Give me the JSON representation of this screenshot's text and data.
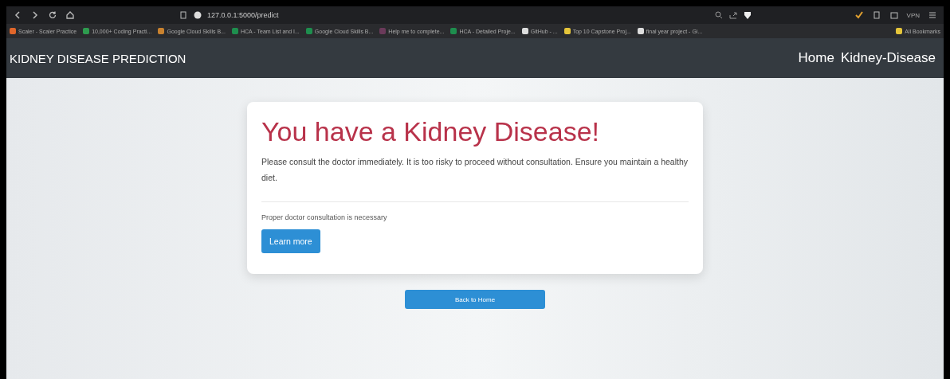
{
  "browser": {
    "url": "127.0.0.1:5000/predict",
    "vpn": "VPN",
    "bookmarks": [
      {
        "label": "Scaler - Scaler Practice",
        "color": "#e0662a"
      },
      {
        "label": "10,000+ Coding Practi...",
        "color": "#2e9b4f"
      },
      {
        "label": "Google Cloud Skills B...",
        "color": "#c9822f"
      },
      {
        "label": "HCA - Team List and I...",
        "color": "#1e8e4e"
      },
      {
        "label": "Google Cloud Skills B...",
        "color": "#1e8e4e"
      },
      {
        "label": "Help me to complete...",
        "color": "#6a3a5a"
      },
      {
        "label": "HCA - Detailed Proje...",
        "color": "#1e8e4e"
      },
      {
        "label": "GitHub - ...",
        "color": "#dddddd"
      },
      {
        "label": "Top 10 Capstone Proj...",
        "color": "#e5c53a"
      },
      {
        "label": "final year project - Gi...",
        "color": "#dddddd"
      }
    ],
    "all_bookmarks": "All Bookmarks"
  },
  "navbar": {
    "brand": "KIDNEY DISEASE PREDICTION",
    "links": [
      "Home",
      "Kidney-Disease"
    ]
  },
  "result": {
    "title": "You have a Kidney Disease!",
    "message": "Please consult the doctor immediately. It is too risky to proceed without consultation. Ensure you maintain a healthy diet.",
    "note": "Proper doctor consultation is necessary",
    "button": "Learn more"
  },
  "back_button": "Back to Home"
}
